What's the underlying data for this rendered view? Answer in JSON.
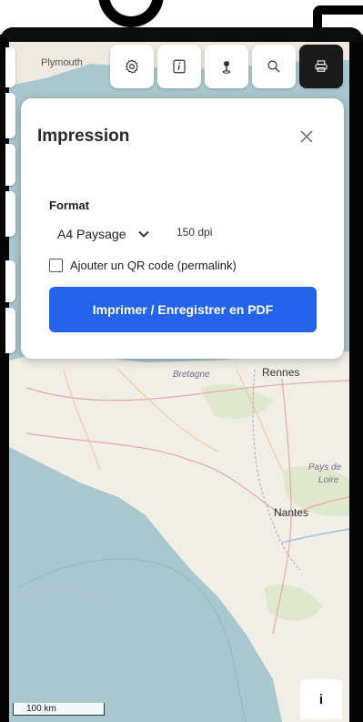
{
  "toolbar": {
    "items": [
      {
        "icon": "gear-icon"
      },
      {
        "icon": "info-box-icon"
      },
      {
        "icon": "map-pin-icon"
      },
      {
        "icon": "search-icon"
      },
      {
        "icon": "printer-icon",
        "active": true
      }
    ]
  },
  "map": {
    "labels": {
      "plymouth": "Plymouth",
      "rennes": "Rennes",
      "bretagne": "Bretagne",
      "pays_de_loire_1": "Pays de",
      "pays_de_loire_2": "Loire",
      "nantes": "Nantes"
    },
    "scale_label": "100 km",
    "info_label": "i"
  },
  "print_panel": {
    "title": "Impression",
    "format_label": "Format",
    "format_value": "A4 Paysage",
    "dpi": "150 dpi",
    "qr_label": "Ajouter un QR code (permalink)",
    "qr_checked": false,
    "print_button": "Imprimer / Enregistrer en PDF"
  },
  "colors": {
    "accent": "#2563eb",
    "sea": "#a9c7cf",
    "land": "#f1eee6"
  }
}
